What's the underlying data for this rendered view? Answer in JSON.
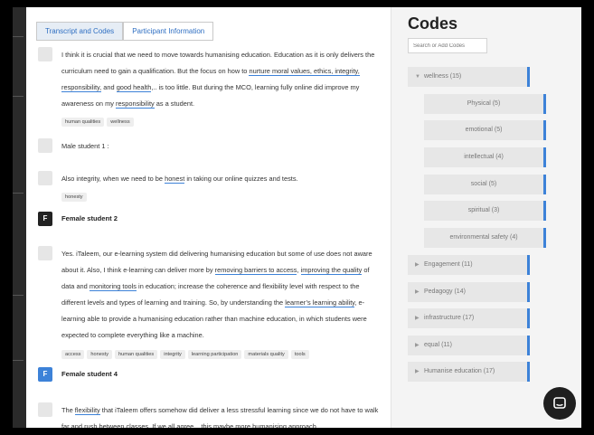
{
  "tabs": [
    "Transcript and Codes",
    "Participant Information"
  ],
  "transcript": {
    "b1": {
      "s1": "I think it is crucial that we need to move towards humanising education. Education as it is only delivers the curriculum need to gain a qualification. But the focus on how to ",
      "h1": "nurture moral values, ethics, integrity, responsibility,",
      "s2": " and ",
      "h2": "good health",
      "s3": ",.. is too little. But during the MCO, learning fully online did improve my awareness on my ",
      "h3": "responsibility",
      "s4": " as a student.",
      "tags": [
        "human qualities",
        "wellness"
      ]
    },
    "b2": {
      "text": "Male student 1 :"
    },
    "b3": {
      "s1": "Also integrity, when we need to be ",
      "h1": "honest",
      "s2": " in taking our online quizzes and tests.",
      "tags": [
        "honesty"
      ]
    },
    "b4": {
      "avatar": "F",
      "speaker": "Female student 2"
    },
    "b5": {
      "s1": "Yes. iTaleem, our e-learning system did delivering humanising education but some of use does not aware about it. Also, I think e-learning can deliver more by ",
      "h1": "removing barriers to access",
      "s2": ", ",
      "h2": "improving the quality",
      "s3": " of data and ",
      "h3": "monitoring tools",
      "s4": " in education; increase the coherence and flexibility level with respect to the different levels and types of learning and training. So, by understanding the ",
      "h4": "learner’s learning ability",
      "s5": ", e-learning able to provide a humanising education rather than machine education, in which students were expected to complete everything like a machine.",
      "tags": [
        "access",
        "honesty",
        "human qualities",
        "integrity",
        "learning participation",
        "materials quality",
        "tools"
      ]
    },
    "b6": {
      "avatar": "F",
      "speaker": "Female student 4"
    },
    "b7": {
      "s1": "The ",
      "h1": "flexibility",
      "s2": " that iTaleem offers somehow did deliver a less stressful learning since we do not have to walk far and rush between classes. If we all agree, ..this maybe more humanising approach"
    }
  },
  "codes": {
    "title": "Codes",
    "search_placeholder": "Search or Add Codes",
    "wellness": "wellness (15)",
    "wellness_children": [
      "Physical (5)",
      "emotional (5)",
      "intellectual (4)",
      "social (5)",
      "spiritual (3)",
      "environmental safety (4)"
    ],
    "others": [
      "Engagement (11)",
      "Pedagogy (14)",
      "infrastructure (17)",
      "equal (11)",
      "Humanise education (17)"
    ]
  },
  "colors": {
    "accent": "#3d82d8",
    "highlight_underline": "#3d82d8",
    "avatar_dark": "#222222",
    "avatar_blue": "#3d82d8"
  },
  "icons": {
    "chat": "chat-bubble-icon",
    "expanded": "caret-down-icon",
    "collapsed": "caret-right-icon"
  }
}
